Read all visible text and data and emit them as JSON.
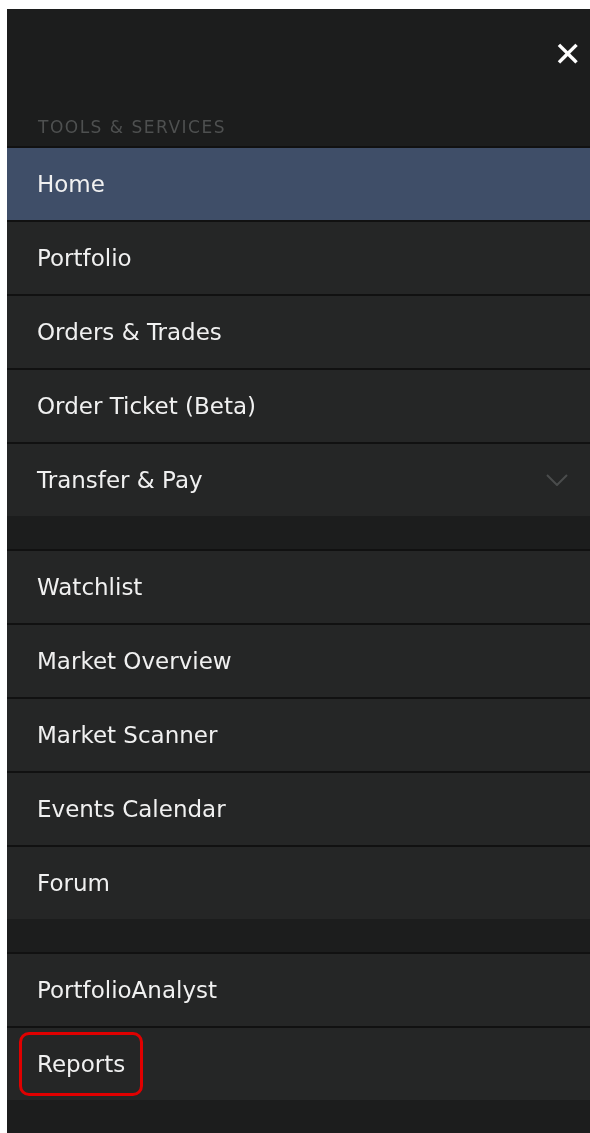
{
  "close_button": {
    "label": "✕"
  },
  "section_title": "TOOLS & SERVICES",
  "groups": [
    {
      "items": [
        {
          "label": "Home",
          "selected": true,
          "highlighted": false
        },
        {
          "label": "Portfolio",
          "selected": false,
          "highlighted": false
        },
        {
          "label": "Orders & Trades",
          "selected": false,
          "highlighted": false
        },
        {
          "label": "Order Ticket (Beta)",
          "selected": false,
          "highlighted": false
        },
        {
          "label": "Transfer & Pay",
          "selected": false,
          "highlighted": false,
          "expanded": false
        }
      ]
    },
    {
      "items": [
        {
          "label": "Watchlist",
          "selected": false,
          "highlighted": false
        },
        {
          "label": "Market Overview",
          "selected": false,
          "highlighted": false
        },
        {
          "label": "Market Scanner",
          "selected": false,
          "highlighted": false
        },
        {
          "label": "Events Calendar",
          "selected": false,
          "highlighted": false
        },
        {
          "label": "Forum",
          "selected": false,
          "highlighted": false
        }
      ]
    },
    {
      "items": [
        {
          "label": "PortfolioAnalyst",
          "selected": false,
          "highlighted": false
        },
        {
          "label": "Reports",
          "selected": false,
          "highlighted": true
        }
      ]
    }
  ]
}
